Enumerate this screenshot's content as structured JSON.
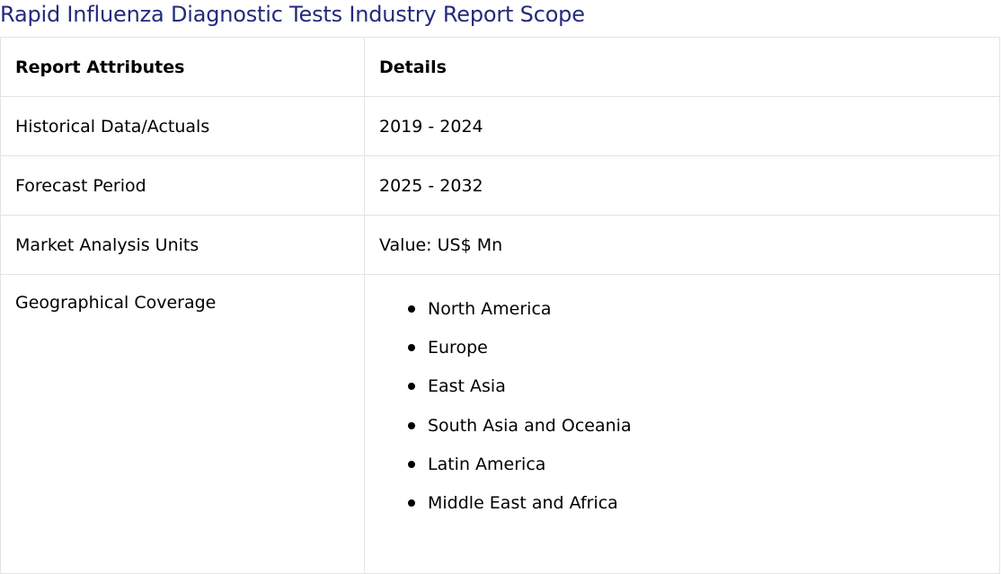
{
  "title": "Rapid Influenza Diagnostic Tests Industry Report Scope",
  "colors": {
    "title": "#252a7a",
    "border": "#e3e3e3"
  },
  "table": {
    "headers": {
      "attribute": "Report Attributes",
      "details": "Details"
    },
    "rows": [
      {
        "attribute": "Historical Data/Actuals",
        "details": "2019 - 2024"
      },
      {
        "attribute": "Forecast Period",
        "details": "2025 - 2032"
      },
      {
        "attribute": "Market Analysis Units",
        "details": "Value: US$ Mn"
      }
    ],
    "geography": {
      "attribute": "Geographical Coverage",
      "regions": [
        "North America",
        "Europe",
        "East Asia",
        "South Asia and Oceania",
        "Latin America",
        "Middle East and Africa"
      ]
    }
  }
}
